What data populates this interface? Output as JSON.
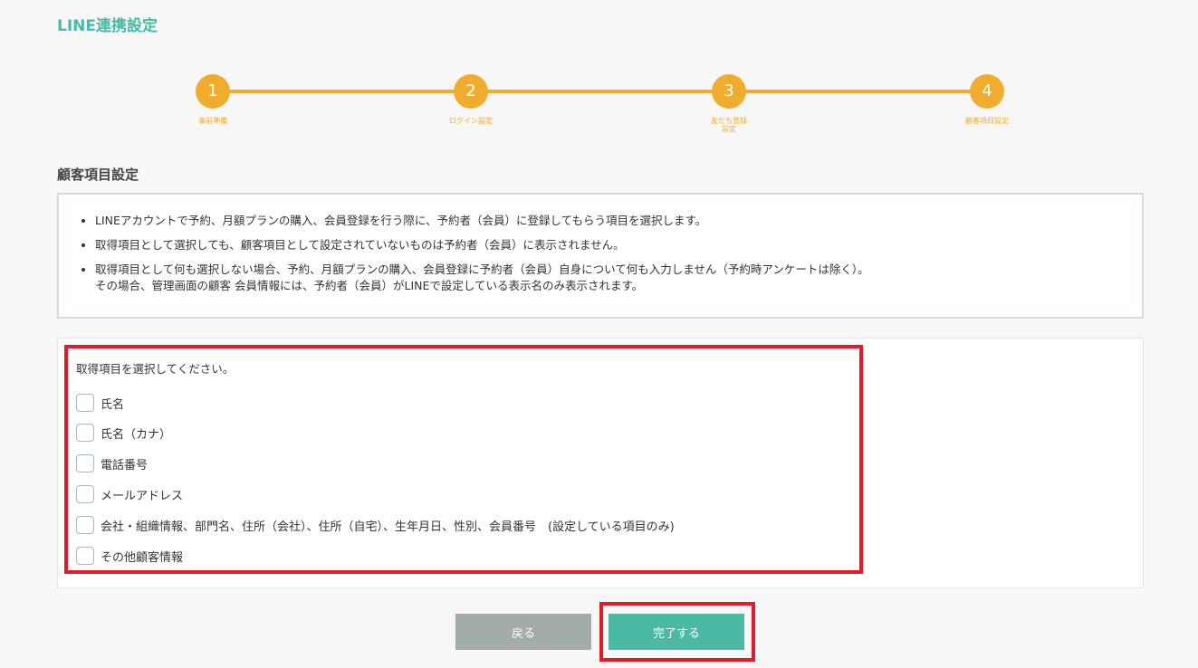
{
  "page": {
    "title": "LINE連携設定"
  },
  "stepper": {
    "accent": "#f0ac2e",
    "steps": [
      {
        "number": "1",
        "label": "事前準備"
      },
      {
        "number": "2",
        "label": "ログイン設定"
      },
      {
        "number": "3",
        "label": "友だち登録\n設定"
      },
      {
        "number": "4",
        "label": "顧客項目設定"
      }
    ]
  },
  "section": {
    "title": "顧客項目設定"
  },
  "info": {
    "bullets": [
      "LINEアカウントで予約、月額プランの購入、会員登録を行う際に、予約者（会員）に登録してもらう項目を選択します。",
      "取得項目として選択しても、顧客項目として設定されていないものは予約者（会員）に表示されません。",
      "取得項目として何も選択しない場合、予約、月額プランの購入、会員登録に予約者（会員）自身について何も入力しません（予約時アンケートは除く）。\nその場合、管理画面の顧客 会員情報には、予約者（会員）がLINEで設定している表示名のみ表示されます。"
    ]
  },
  "form": {
    "prompt": "取得項目を選択してください。",
    "options": [
      {
        "label": "氏名",
        "checked": false
      },
      {
        "label": "氏名（カナ）",
        "checked": false
      },
      {
        "label": "電話番号",
        "checked": false
      },
      {
        "label": "メールアドレス",
        "checked": false
      },
      {
        "label": "会社・組織情報、部門名、住所（会社）、住所（自宅）、生年月日、性別、会員番号　(設定している項目のみ)",
        "checked": false
      },
      {
        "label": "その他顧客情報",
        "checked": false
      }
    ]
  },
  "buttons": {
    "back_label": "戻る",
    "done_label": "完了する"
  },
  "colors": {
    "brand": "#4cb9a5",
    "highlight": "#e21b2b",
    "back_button": "#a4acab"
  }
}
